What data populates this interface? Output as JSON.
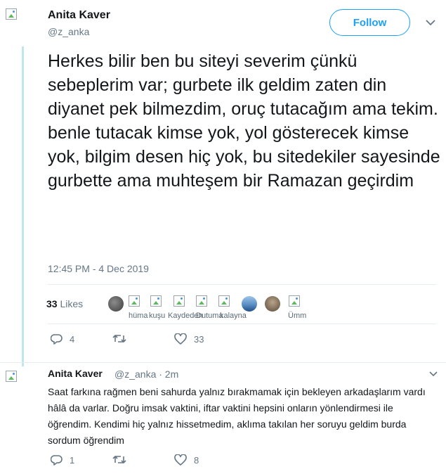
{
  "tweet": {
    "name": "Anita Kaver",
    "handle": "@z_anka",
    "follow_label": "Follow",
    "text": "Herkes bilir ben bu siteyi severim çünkü sebeplerim var; gurbete ilk geldim zaten din diyanet pek bilmezdim, oruç tutacağım ama tekim. benle tutacak kimse yok, yol gösterecek kimse yok, bilgim desen hiç yok, bu sitedekiler sayesinde gurbette ama muhteşem bir Ramazan geçirdim",
    "timestamp": "12:45 PM - 4 Dec 2019",
    "likes_count": "33",
    "likes_label": "Likes",
    "liker_names": [
      "hüma",
      "kuşu",
      "Kaydeden",
      "Dutuma",
      "kalayna",
      "Ümm"
    ],
    "actions": {
      "replies": "4",
      "retweets": "",
      "likes": "33"
    }
  },
  "reply": {
    "name": "Anita Kaver",
    "handle_time": "@z_anka · 2m",
    "text": "Saat farkına rağmen beni sahurda yalnız bırakmamak için bekleyen arkadaşlarım vardı hâlâ da varlar. Doğru imsak vaktini, iftar vaktini hepsini onların yönlendirmesi ile öğrendim. Kendimi hiç yalnız hissetmedim, aklıma takılan her soruyu geldim burda sordum öğrendim",
    "actions": {
      "replies": "1",
      "retweets": "",
      "likes": "8"
    }
  },
  "icons": {
    "reply": "reply-icon",
    "retweet": "retweet-icon",
    "like": "heart-icon",
    "more": "chevron-down-icon",
    "accent": "#1da1f2",
    "thread_line": "#bfe6e9"
  }
}
